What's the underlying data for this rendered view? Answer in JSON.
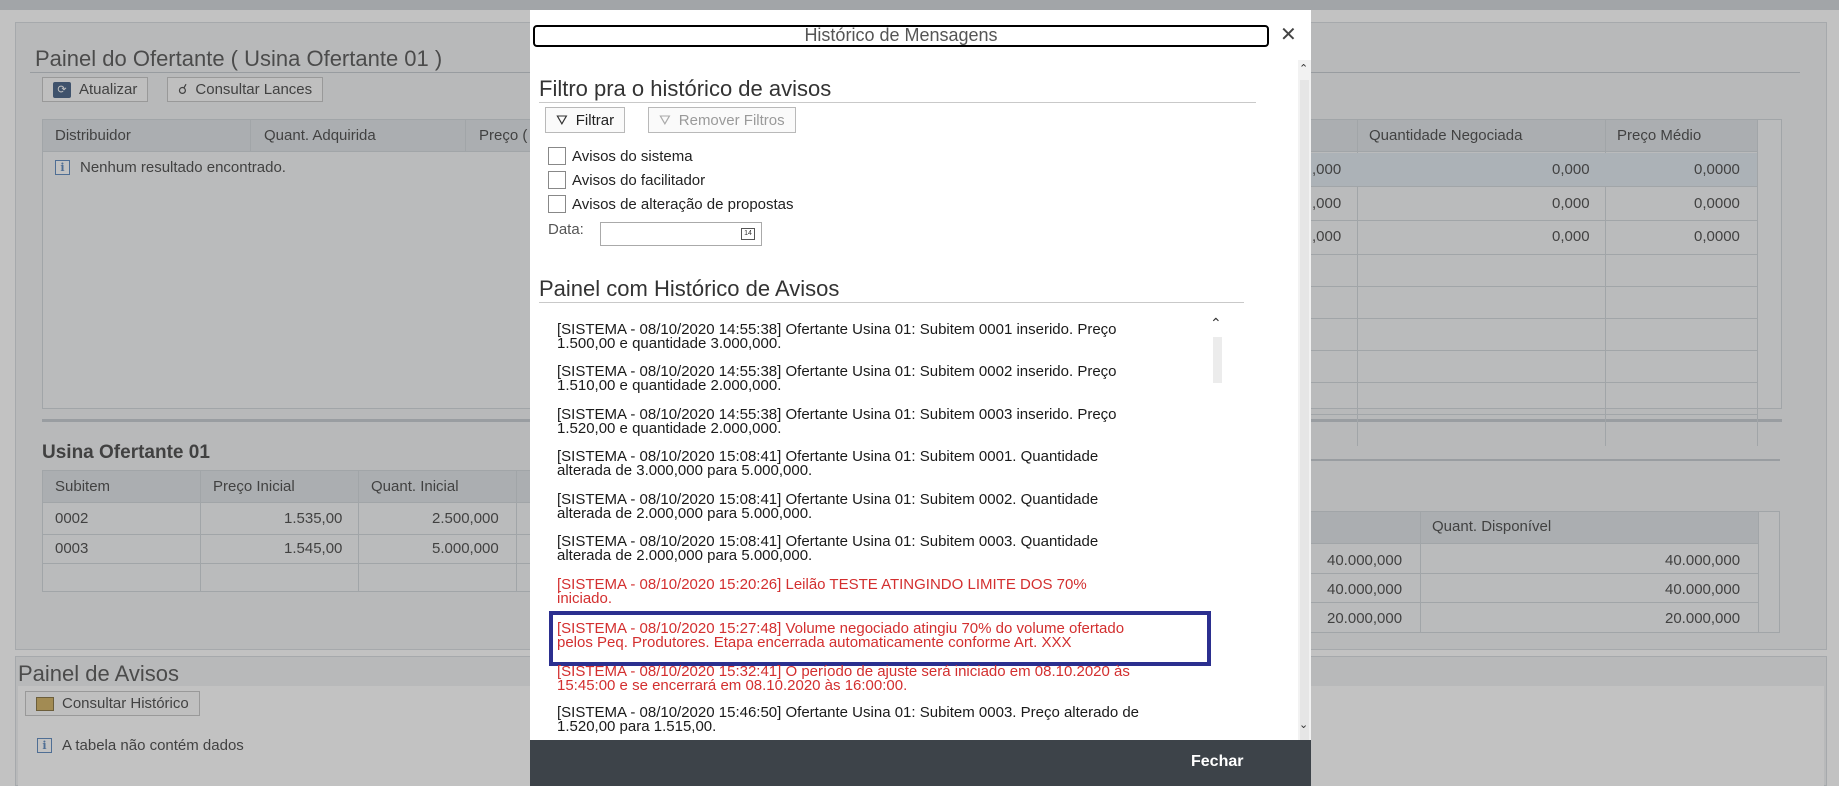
{
  "background": {
    "panel_title": "Painel do Ofertante ( Usina Ofertante 01 )",
    "toolbar": {
      "refresh_label": "Atualizar",
      "bids_label": "Consultar Lances"
    },
    "distributors_table": {
      "headers": [
        "Distribuidor",
        "Quant. Adquirida",
        "Preço ("
      ],
      "empty_message": "Nenhum resultado encontrado."
    },
    "right_table": {
      "headers": [
        "Quantidade Negociada",
        "Preço Médio"
      ],
      "rows": [
        [
          ",000",
          "0,000",
          "0,0000"
        ],
        [
          ",000",
          "0,000",
          "0,0000"
        ],
        [
          ",000",
          "0,000",
          "0,0000"
        ]
      ]
    },
    "usina_title": "Usina Ofertante 01",
    "subitem_table": {
      "headers": [
        "Subitem",
        "Preço Inicial",
        "Quant. Inicial"
      ],
      "rows": [
        [
          "0002",
          "1.535,00",
          "2.500,000"
        ],
        [
          "0003",
          "1.545,00",
          "5.000,000"
        ]
      ]
    },
    "available_table": {
      "header": "Quant. Disponível",
      "rows": [
        [
          "40.000,000",
          "40.000,000"
        ],
        [
          "40.000,000",
          "40.000,000"
        ],
        [
          "20.000,000",
          "20.000,000"
        ]
      ]
    },
    "avisos_title": "Painel de Avisos",
    "avisos_button": "Consultar Histórico",
    "avisos_empty": "A tabela não contém dados"
  },
  "modal": {
    "title": "Histórico de Mensagens",
    "close_glyph": "✕",
    "filter_title": "Filtro pra o histórico de avisos",
    "filter_button": "Filtrar",
    "remove_filters_button": "Remover Filtros",
    "checkboxes": [
      "Avisos do sistema",
      "Avisos do facilitador",
      "Avisos de alteração de propostas"
    ],
    "date_label": "Data:",
    "date_value": "",
    "history_title": "Painel com Histórico de Avisos",
    "messages": [
      {
        "l1": "[SISTEMA - 08/10/2020 14:55:38] Ofertante Usina 01: Subitem 0001 inserido. Preço",
        "l2": "1.500,00 e quantidade 3.000,000."
      },
      {
        "l1": "[SISTEMA - 08/10/2020 14:55:38] Ofertante Usina 01: Subitem 0002 inserido. Preço",
        "l2": "1.510,00 e quantidade 2.000,000."
      },
      {
        "l1": "[SISTEMA - 08/10/2020 14:55:38] Ofertante Usina 01: Subitem 0003 inserido. Preço",
        "l2": "1.520,00 e quantidade 2.000,000."
      },
      {
        "l1": "[SISTEMA - 08/10/2020 15:08:41] Ofertante Usina 01: Subitem 0001. Quantidade",
        "l2": "alterada de 3.000,000 para 5.000,000."
      },
      {
        "l1": "[SISTEMA - 08/10/2020 15:08:41] Ofertante Usina 01: Subitem 0002. Quantidade",
        "l2": "alterada de 2.000,000 para 5.000,000."
      },
      {
        "l1": "[SISTEMA - 08/10/2020 15:08:41] Ofertante Usina 01: Subitem 0003. Quantidade",
        "l2": "alterada de 2.000,000 para 5.000,000."
      },
      {
        "l1": "[SISTEMA - 08/10/2020 15:20:26] Leilão TESTE ATINGINDO LIMITE DOS 70%",
        "l2": "iniciado."
      },
      {
        "l1": "[SISTEMA - 08/10/2020 15:27:48] Volume negociado atingiu 70% do volume ofertado",
        "l2": "pelos Peq. Produtores. Etapa encerrada automaticamente conforme Art. XXX"
      },
      {
        "l1": "[SISTEMA - 08/10/2020 15:32:41] O período de ajuste será iniciado em 08.10.2020 às",
        "l2": "15:45:00 e se encerrará em 08.10.2020 às 16:00:00."
      },
      {
        "l1": "[SISTEMA - 08/10/2020 15:46:50] Ofertante Usina 01: Subitem 0003. Preço alterado de",
        "l2": "1.520,00 para 1.515,00."
      }
    ],
    "footer_button": "Fechar"
  },
  "colors": {
    "overlay": "#8a8a8a",
    "message_red": "#d32f2f",
    "highlight_border": "#2b2f8f",
    "footer": "#3d4349"
  }
}
